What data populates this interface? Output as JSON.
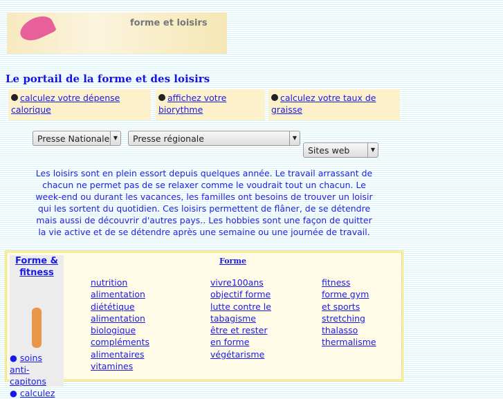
{
  "banner": {
    "logo_text": "forme et loisirs"
  },
  "title": "Le portail de la forme et des loisirs",
  "tools": [
    {
      "label": "calculez votre dépense calorique"
    },
    {
      "label": "affichez votre biorythme"
    },
    {
      "label": "calculez votre taux de graisse"
    }
  ],
  "selects": {
    "national": "Presse Nationale",
    "regional": "Presse régionale",
    "web": "Sites web"
  },
  "intro": "Les loisirs sont en plein essort depuis quelques année. Le travail arrassant de chacun ne permet pas de se relaxer comme le voudrait tout un chacun. Le week-end ou durant les vacances, les familles ont besoins de trouver un loisir qui les sortent du quotidien. Ces loisirs permettent de flâner, de se détendre mais aussi de découvrir d'autres pays.. Les hobbies sont une façon de quitter la vie active et de se détendre après une semaine ou une journée de travail.",
  "sidebar": {
    "title": "Forme & fitness",
    "links": [
      "soins anti-capitons",
      "calculez"
    ]
  },
  "forme": {
    "heading": "Forme",
    "col1": [
      "nutrition",
      "alimentation",
      "diététique",
      "alimentation",
      "biologique",
      "compléments",
      "alimentaires",
      "vitamines"
    ],
    "col2": [
      "vivre100ans",
      "objectif forme",
      "lutte contre le",
      "tabagisme",
      "être et rester",
      "en forme",
      "végétarisme"
    ],
    "col3": [
      "fitness",
      "forme gym",
      "et sports",
      "stretching",
      "thalasso",
      "thermalisme"
    ]
  }
}
